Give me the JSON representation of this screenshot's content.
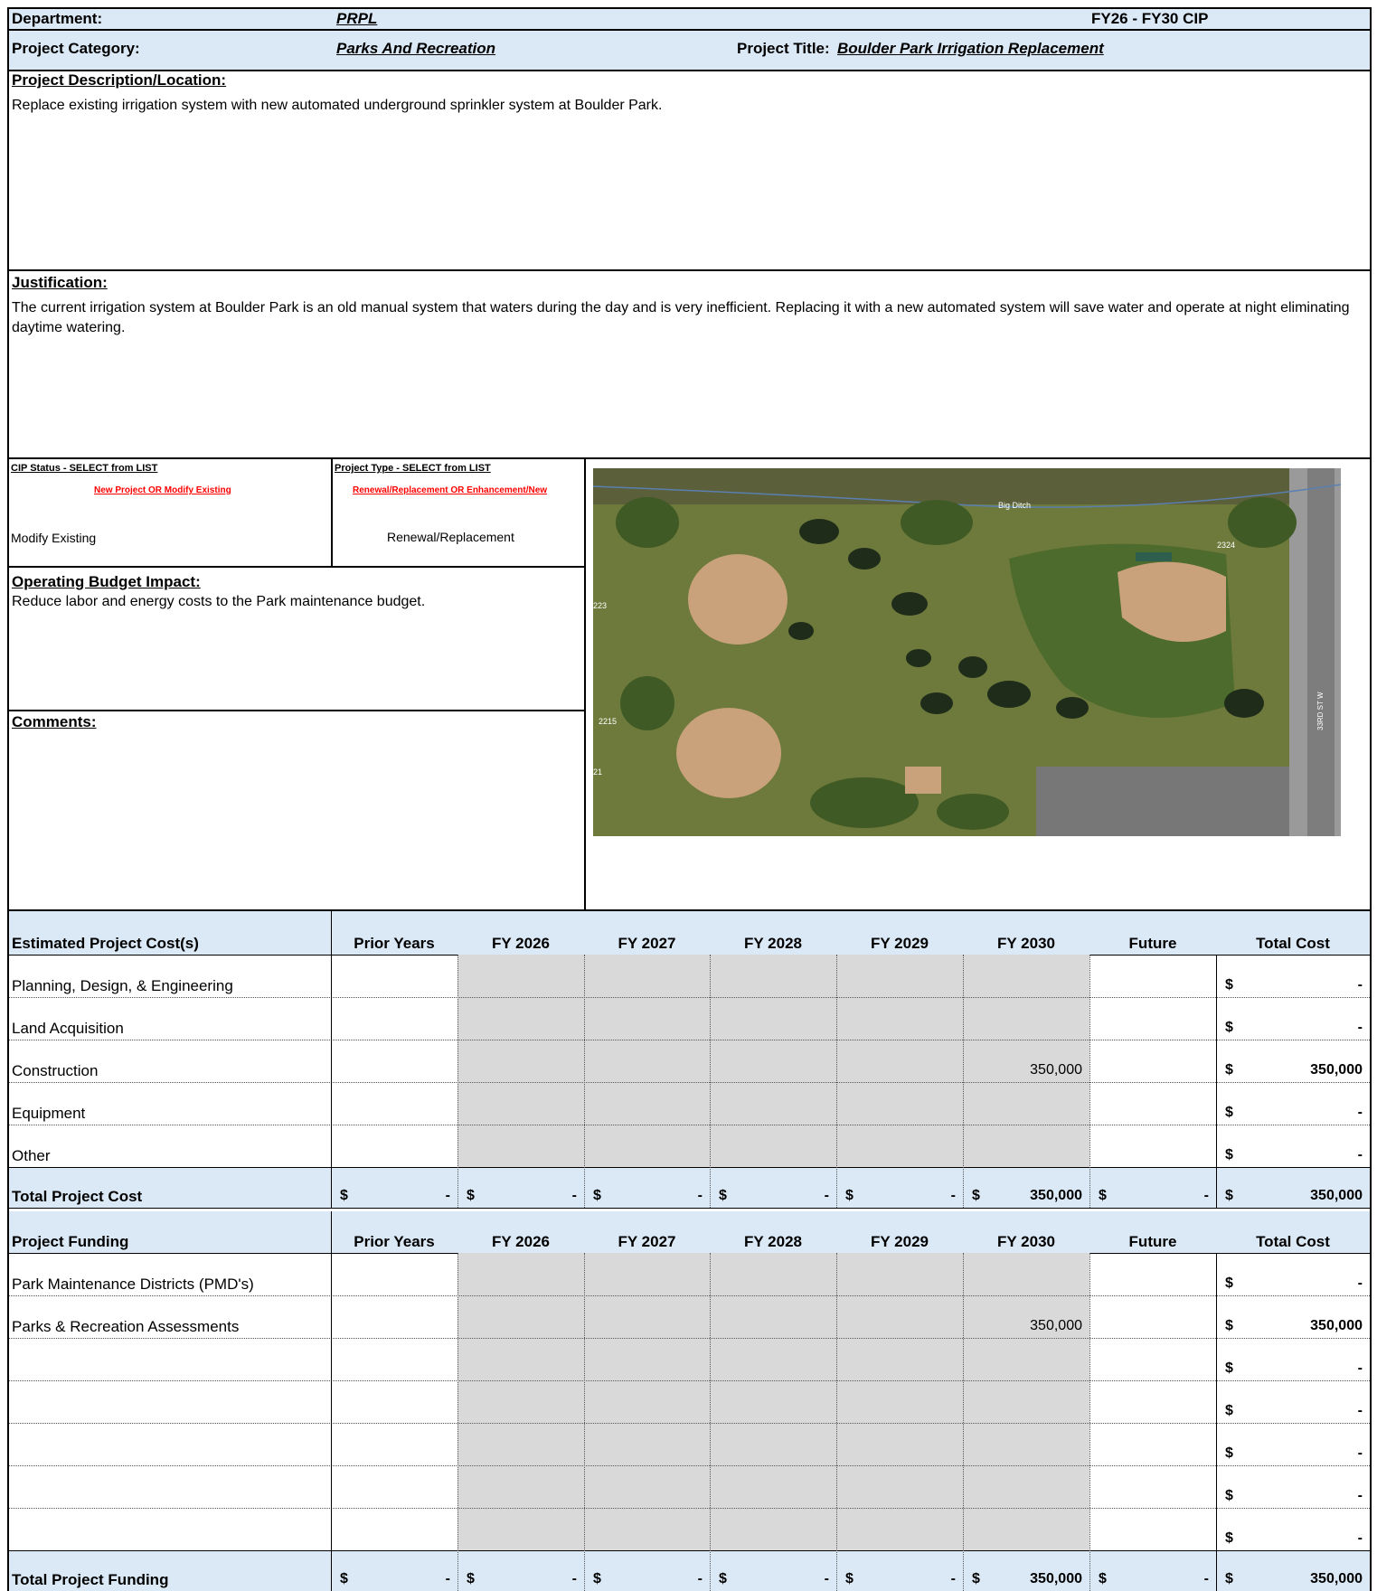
{
  "header": {
    "department_label": "Department:",
    "department_value": "PRPL",
    "cip_range": "FY26 - FY30 CIP",
    "category_label": "Project Category:",
    "category_value": "Parks And Recreation",
    "title_label": "Project Title:",
    "title_value": "Boulder Park Irrigation Replacement"
  },
  "description": {
    "label": "Project Description/Location:",
    "text": "Replace existing irrigation system with new automated underground sprinkler system at Boulder Park."
  },
  "justification": {
    "label": "Justification:",
    "text": "The current irrigation system at Boulder Park is an old manual system that waters during the day and is very inefficient.  Replacing it with a new automated system will save water and  operate at night eliminating daytime watering."
  },
  "cip_status": {
    "label": "CIP Status - SELECT from LIST",
    "hint": "New Project OR  Modify Existing",
    "value": "Modify Existing"
  },
  "project_type": {
    "label": "Project Type - SELECT from LIST",
    "hint": "Renewal/Replacement OR Enhancement/New",
    "value": "Renewal/Replacement"
  },
  "operating_impact": {
    "label": "Operating Budget Impact:",
    "text": "Reduce labor and energy costs to the Park maintenance budget."
  },
  "comments": {
    "label": "Comments:",
    "text": ""
  },
  "map": {
    "labels": {
      "ditch": "Big Ditch",
      "parcel_a": "2324",
      "parcel_b": "2215",
      "parcel_c": "223",
      "parcel_d": "21",
      "street": "33RD ST W"
    },
    "colors": {
      "grass": "#6e7a3c",
      "dirt": "#c9a27c",
      "tree": "#1f2c1a",
      "road": "#8c8c8c"
    }
  },
  "cost_table": {
    "title": "Estimated Project Cost(s)",
    "columns": [
      "Prior Years",
      "FY 2026",
      "FY 2027",
      "FY 2028",
      "FY 2029",
      "FY 2030",
      "Future",
      "Total Cost"
    ],
    "rows": [
      {
        "label": "Planning, Design, & Engineering",
        "fy2030": "",
        "total": "-"
      },
      {
        "label": "Land Acquisition",
        "fy2030": "",
        "total": "-"
      },
      {
        "label": "Construction",
        "fy2030": "350,000",
        "total": "350,000"
      },
      {
        "label": "Equipment",
        "fy2030": "",
        "total": "-"
      },
      {
        "label": "Other",
        "fy2030": "",
        "total": "-"
      }
    ],
    "total_label": "Total Project Cost",
    "totals": [
      "-",
      "-",
      "-",
      "-",
      "-",
      "350,000",
      "-",
      "350,000"
    ]
  },
  "funding_table": {
    "title": "Project Funding",
    "columns": [
      "Prior Years",
      "FY 2026",
      "FY 2027",
      "FY 2028",
      "FY 2029",
      "FY 2030",
      "Future",
      "Total Cost"
    ],
    "rows": [
      {
        "label": "Park Maintenance Districts (PMD's)",
        "fy2030": "",
        "total": "-"
      },
      {
        "label": "Parks & Recreation Assessments",
        "fy2030": "350,000",
        "total": "350,000"
      },
      {
        "label": "",
        "fy2030": "",
        "total": "-"
      },
      {
        "label": "",
        "fy2030": "",
        "total": "-"
      },
      {
        "label": "",
        "fy2030": "",
        "total": "-"
      },
      {
        "label": "",
        "fy2030": "",
        "total": "-"
      },
      {
        "label": "",
        "fy2030": "",
        "total": "-"
      }
    ],
    "total_label": "Total Project Funding",
    "totals": [
      "-",
      "-",
      "-",
      "-",
      "-",
      "350,000",
      "-",
      "350,000"
    ]
  },
  "currency_symbol": "$",
  "colors": {
    "header_blue": "#dbe9f6",
    "shade_grey": "#d9d9d9",
    "hint_red": "#ff0000"
  }
}
